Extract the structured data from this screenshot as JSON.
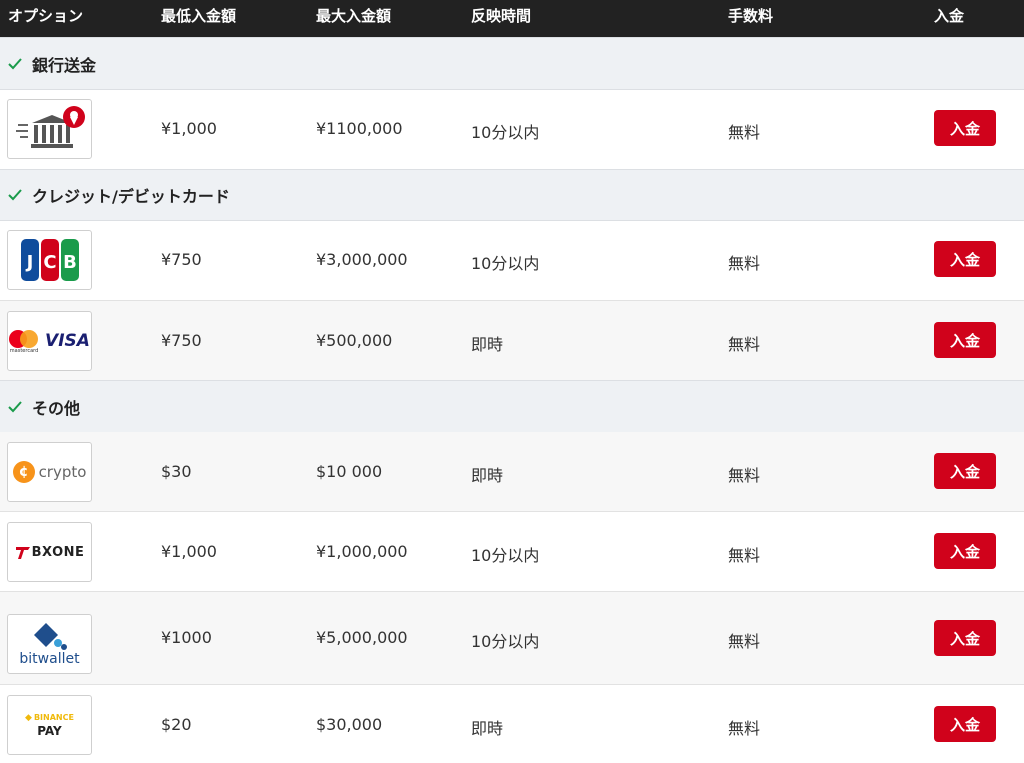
{
  "headers": {
    "option": "オプション",
    "min": "最低入金額",
    "max": "最大入金額",
    "time": "反映時間",
    "fee": "手数料",
    "deposit": "入金"
  },
  "sections": [
    {
      "label": "銀行送金"
    },
    {
      "label": "クレジット/デビットカード"
    },
    {
      "label": "その他"
    }
  ],
  "rows": [
    {
      "logo": "bank-transfer-logo",
      "min": "¥1,000",
      "max": "¥1100,000",
      "time": "10分以内",
      "fee": "無料",
      "button": "入金"
    },
    {
      "logo": "jcb-logo",
      "logo_text": "JCB",
      "min": "¥750",
      "max": "¥3,000,000",
      "time": "10分以内",
      "fee": "無料",
      "button": "入金"
    },
    {
      "logo": "mastercard-visa-logo",
      "logo_text": "VISA",
      "logo_subtext": "mastercard",
      "min": "¥750",
      "max": "¥500,000",
      "time": "即時",
      "fee": "無料",
      "button": "入金"
    },
    {
      "logo": "crypto-logo",
      "logo_text": "crypto",
      "min": "$30",
      "max": "$10 000",
      "time": "即時",
      "fee": "無料",
      "button": "入金"
    },
    {
      "logo": "bxone-logo",
      "logo_text": "BXONE",
      "min": "¥1,000",
      "max": "¥1,000,000",
      "time": "10分以内",
      "fee": "無料",
      "button": "入金"
    },
    {
      "logo": "bitwallet-logo",
      "logo_text": "bitwallet",
      "min": "¥1000",
      "max": "¥5,000,000",
      "time": "10分以内",
      "fee": "無料",
      "button": "入金"
    },
    {
      "logo": "binance-pay-logo",
      "logo_text": "BINANCE",
      "logo_subtext": "PAY",
      "min": "$20",
      "max": "$30,000",
      "time": "即時",
      "fee": "無料",
      "button": "入金"
    }
  ],
  "colors": {
    "header_bg": "#222222",
    "section_bg": "#eef1f4",
    "button": "#d0021b",
    "check": "#1a9b4b"
  }
}
